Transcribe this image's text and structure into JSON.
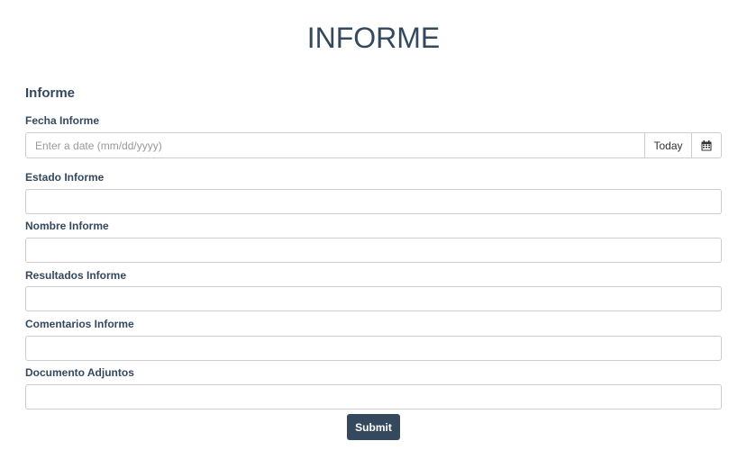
{
  "page": {
    "title": "INFORME"
  },
  "form": {
    "section_title": "Informe",
    "fecha": {
      "label": "Fecha Informe",
      "value": "",
      "placeholder": "Enter a date (mm/dd/yyyy)",
      "today_label": "Today",
      "calendar_icon": "calendar-icon"
    },
    "estado": {
      "label": "Estado Informe",
      "value": ""
    },
    "nombre": {
      "label": "Nombre Informe",
      "value": ""
    },
    "resultados": {
      "label": "Resultados Informe",
      "value": ""
    },
    "comentarios": {
      "label": "Comentarios Informe",
      "value": ""
    },
    "documento": {
      "label": "Documento Adjuntos",
      "value": ""
    },
    "submit_label": "Submit"
  },
  "colors": {
    "primary": "#34495e",
    "border": "#cccccc",
    "background": "#ffffff"
  }
}
